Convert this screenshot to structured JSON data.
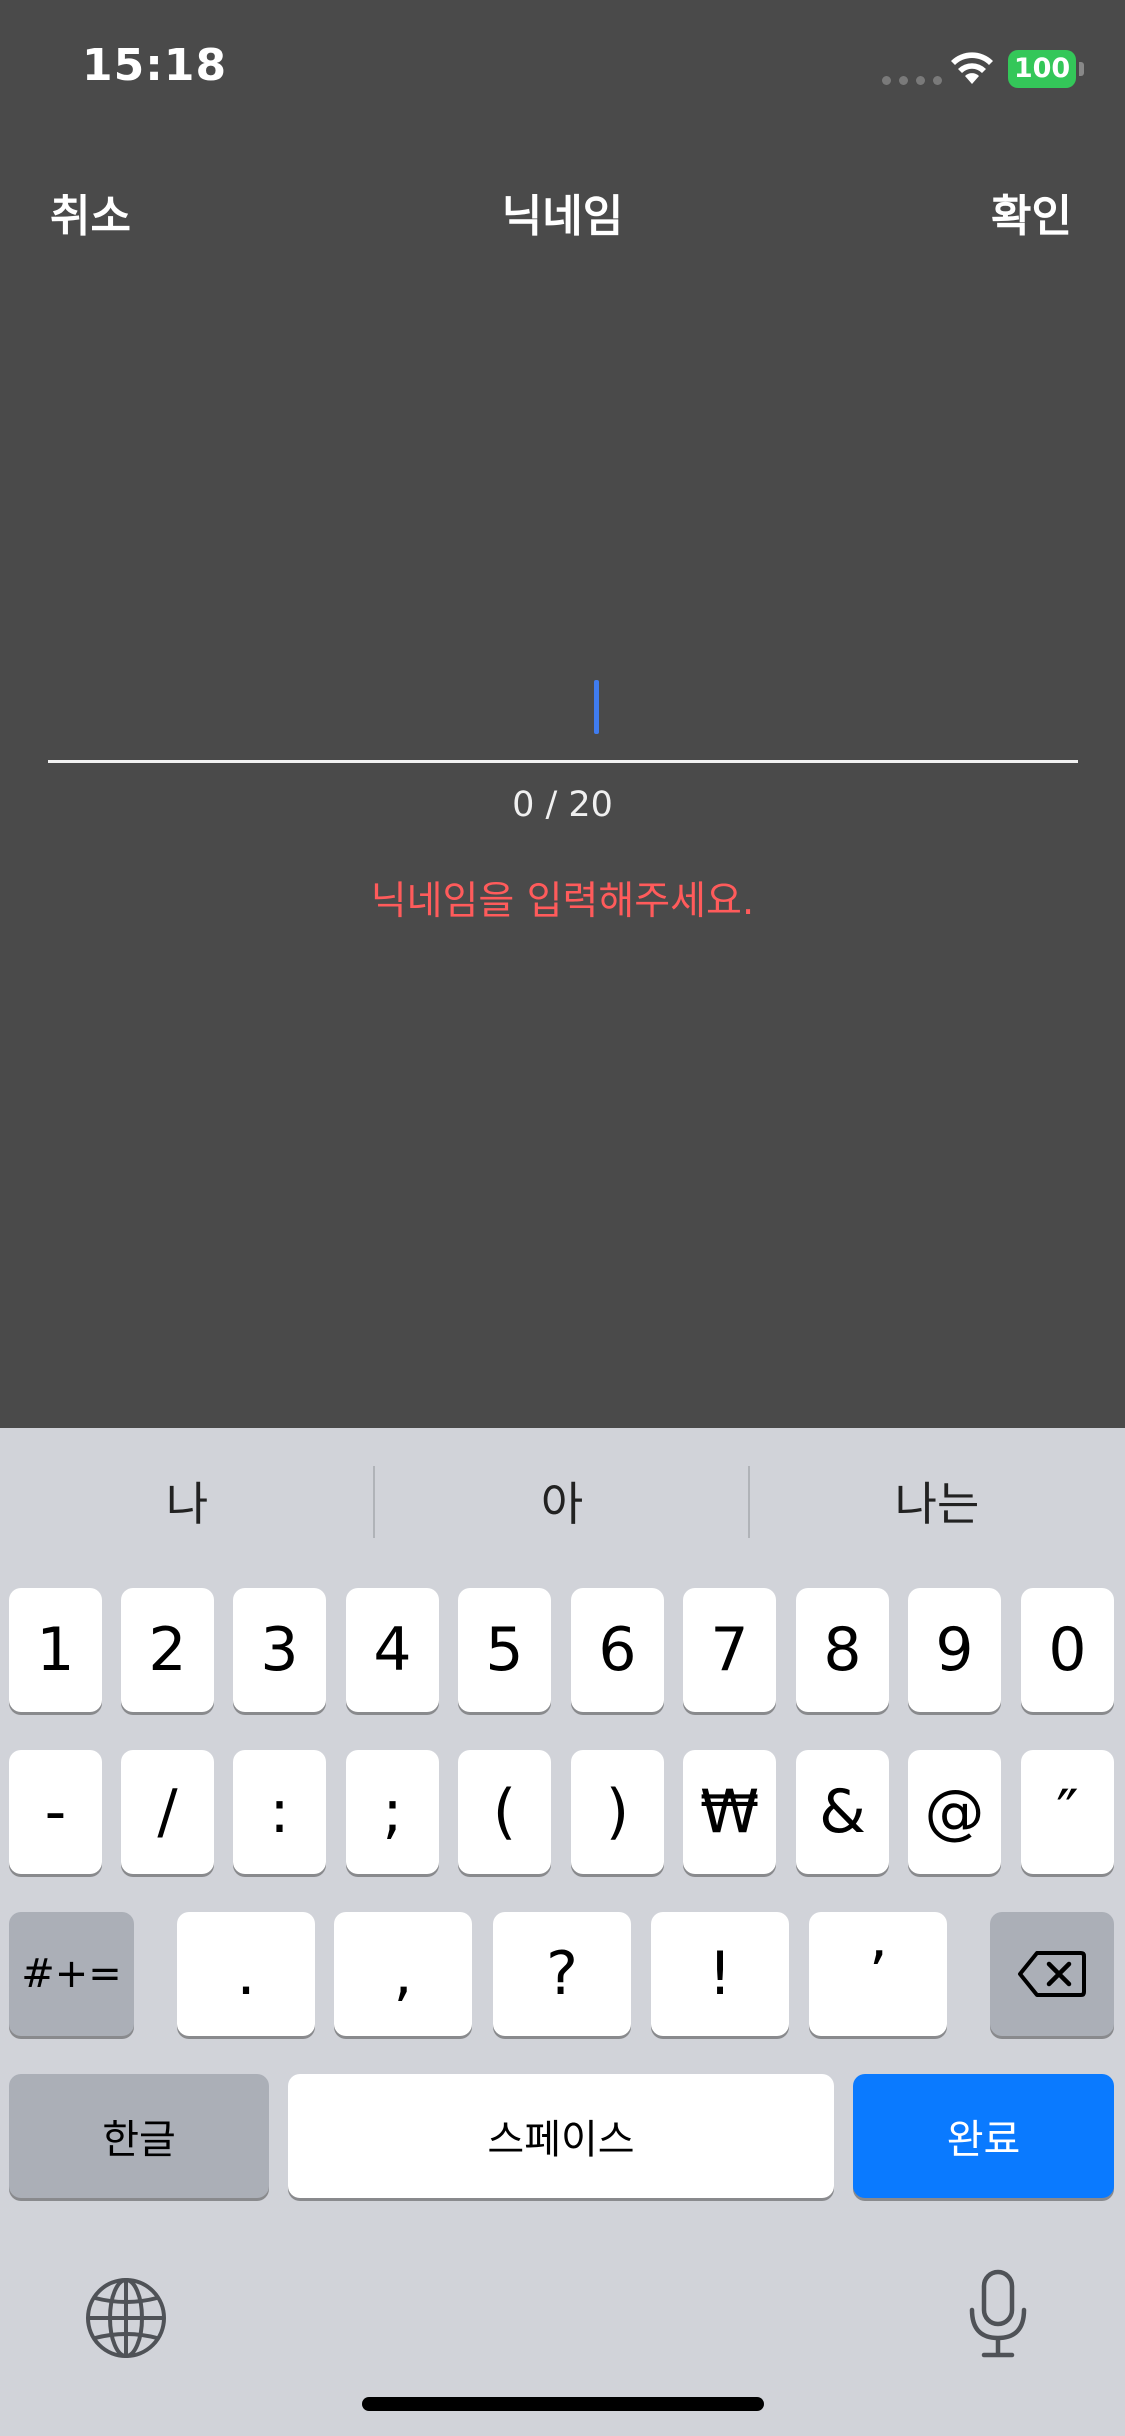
{
  "status_bar": {
    "time": "15:18",
    "battery": "100"
  },
  "nav": {
    "cancel": "취소",
    "title": "닉네임",
    "confirm": "확인"
  },
  "nickname": {
    "value": "",
    "counter": "0 / 20",
    "error": "닉네임을 입력해주세요."
  },
  "keyboard": {
    "suggestions": [
      "나",
      "아",
      "나는"
    ],
    "row1": [
      "1",
      "2",
      "3",
      "4",
      "5",
      "6",
      "7",
      "8",
      "9",
      "0"
    ],
    "row2": [
      "-",
      "/",
      ":",
      ";",
      "(",
      ")",
      "₩",
      "&",
      "@",
      "″"
    ],
    "row3": {
      "symbols": "#+=",
      "keys": [
        ".",
        ",",
        "?",
        "!",
        "’"
      ]
    },
    "bottom": {
      "hangul": "한글",
      "space": "스페이스",
      "done": "완료"
    }
  },
  "colors": {
    "background": "#4a4a4a",
    "error": "#ff5b5b",
    "caret": "#3f7cf0",
    "done_key": "#0a7aff",
    "keyboard_bg": "#d1d3d9"
  },
  "icons": [
    "signal-dots-icon",
    "wifi-icon",
    "battery-icon",
    "delete-key-icon",
    "globe-icon",
    "microphone-icon"
  ]
}
